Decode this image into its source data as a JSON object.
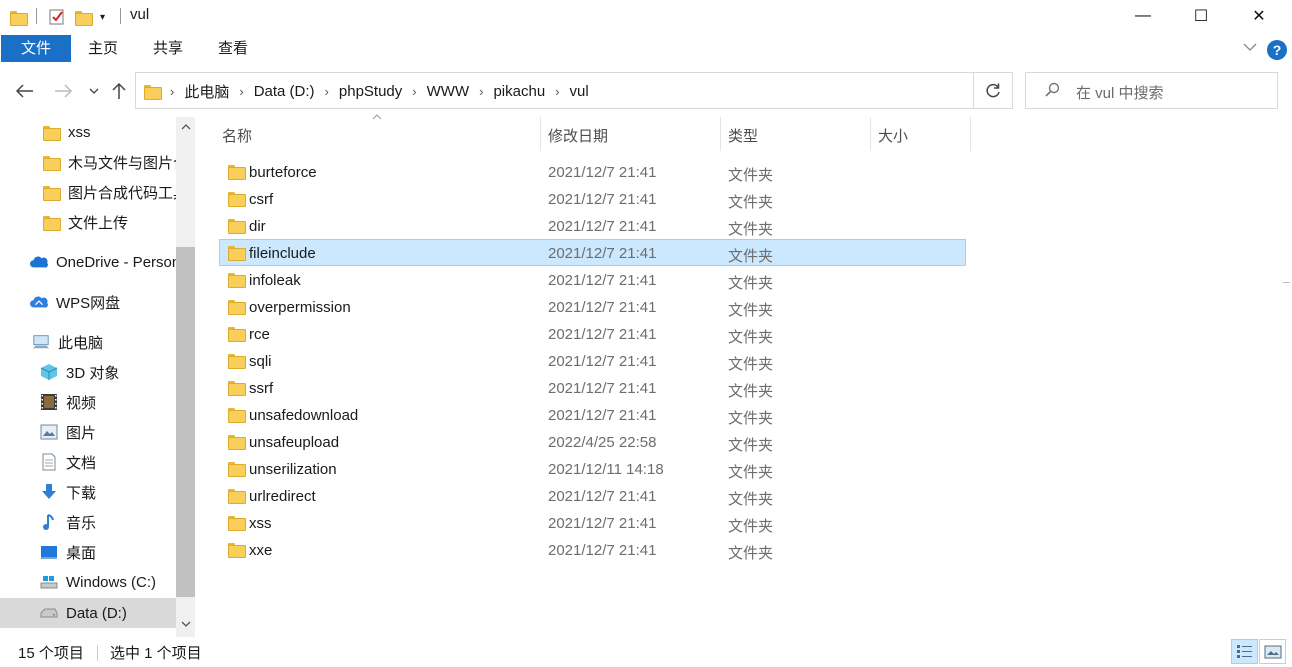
{
  "window": {
    "title": "vul",
    "minimize": "—",
    "maximize": "☐",
    "close": "✕"
  },
  "ribbon": {
    "tabs": [
      "文件",
      "主页",
      "共享",
      "查看"
    ],
    "help": "?"
  },
  "address": {
    "crumbs": [
      "此电脑",
      "Data (D:)",
      "phpStudy",
      "WWW",
      "pikachu",
      "vul"
    ]
  },
  "search": {
    "placeholder": "在 vul 中搜索"
  },
  "sidebar": {
    "items": [
      {
        "label": "xss",
        "icon": "folder-icon"
      },
      {
        "label": "木马文件与图片合成",
        "icon": "folder-icon"
      },
      {
        "label": "图片合成代码工具",
        "icon": "folder-icon"
      },
      {
        "label": "文件上传",
        "icon": "folder-icon"
      },
      {
        "label": "OneDrive - Personal",
        "icon": "onedrive-icon"
      },
      {
        "label": "WPS网盘",
        "icon": "wps-cloud-icon"
      },
      {
        "label": "此电脑",
        "icon": "this-pc-icon"
      },
      {
        "label": "3D 对象",
        "icon": "3d-objects-icon"
      },
      {
        "label": "视频",
        "icon": "videos-icon"
      },
      {
        "label": "图片",
        "icon": "pictures-icon"
      },
      {
        "label": "文档",
        "icon": "documents-icon"
      },
      {
        "label": "下载",
        "icon": "downloads-icon"
      },
      {
        "label": "音乐",
        "icon": "music-icon"
      },
      {
        "label": "桌面",
        "icon": "desktop-icon"
      },
      {
        "label": "Windows (C:)",
        "icon": "drive-c-icon"
      },
      {
        "label": "Data (D:)",
        "icon": "drive-d-icon"
      }
    ]
  },
  "columns": {
    "name": "名称",
    "date": "修改日期",
    "type": "类型",
    "size": "大小"
  },
  "files": [
    {
      "name": "burteforce",
      "date": "2021/12/7 21:41",
      "type": "文件夹"
    },
    {
      "name": "csrf",
      "date": "2021/12/7 21:41",
      "type": "文件夹"
    },
    {
      "name": "dir",
      "date": "2021/12/7 21:41",
      "type": "文件夹"
    },
    {
      "name": "fileinclude",
      "date": "2021/12/7 21:41",
      "type": "文件夹"
    },
    {
      "name": "infoleak",
      "date": "2021/12/7 21:41",
      "type": "文件夹"
    },
    {
      "name": "overpermission",
      "date": "2021/12/7 21:41",
      "type": "文件夹"
    },
    {
      "name": "rce",
      "date": "2021/12/7 21:41",
      "type": "文件夹"
    },
    {
      "name": "sqli",
      "date": "2021/12/7 21:41",
      "type": "文件夹"
    },
    {
      "name": "ssrf",
      "date": "2021/12/7 21:41",
      "type": "文件夹"
    },
    {
      "name": "unsafedownload",
      "date": "2021/12/7 21:41",
      "type": "文件夹"
    },
    {
      "name": "unsafeupload",
      "date": "2022/4/25 22:58",
      "type": "文件夹"
    },
    {
      "name": "unserilization",
      "date": "2021/12/11 14:18",
      "type": "文件夹"
    },
    {
      "name": "urlredirect",
      "date": "2021/12/7 21:41",
      "type": "文件夹"
    },
    {
      "name": "xss",
      "date": "2021/12/7 21:41",
      "type": "文件夹"
    },
    {
      "name": "xxe",
      "date": "2021/12/7 21:41",
      "type": "文件夹"
    }
  ],
  "status": {
    "count": "15 个项目",
    "selected": "选中 1 个项目"
  },
  "colors": {
    "accent": "#1a6fc7",
    "selection": "#cce8ff",
    "selection_border": "#99d1ff",
    "folder": "#f8cf5a"
  }
}
